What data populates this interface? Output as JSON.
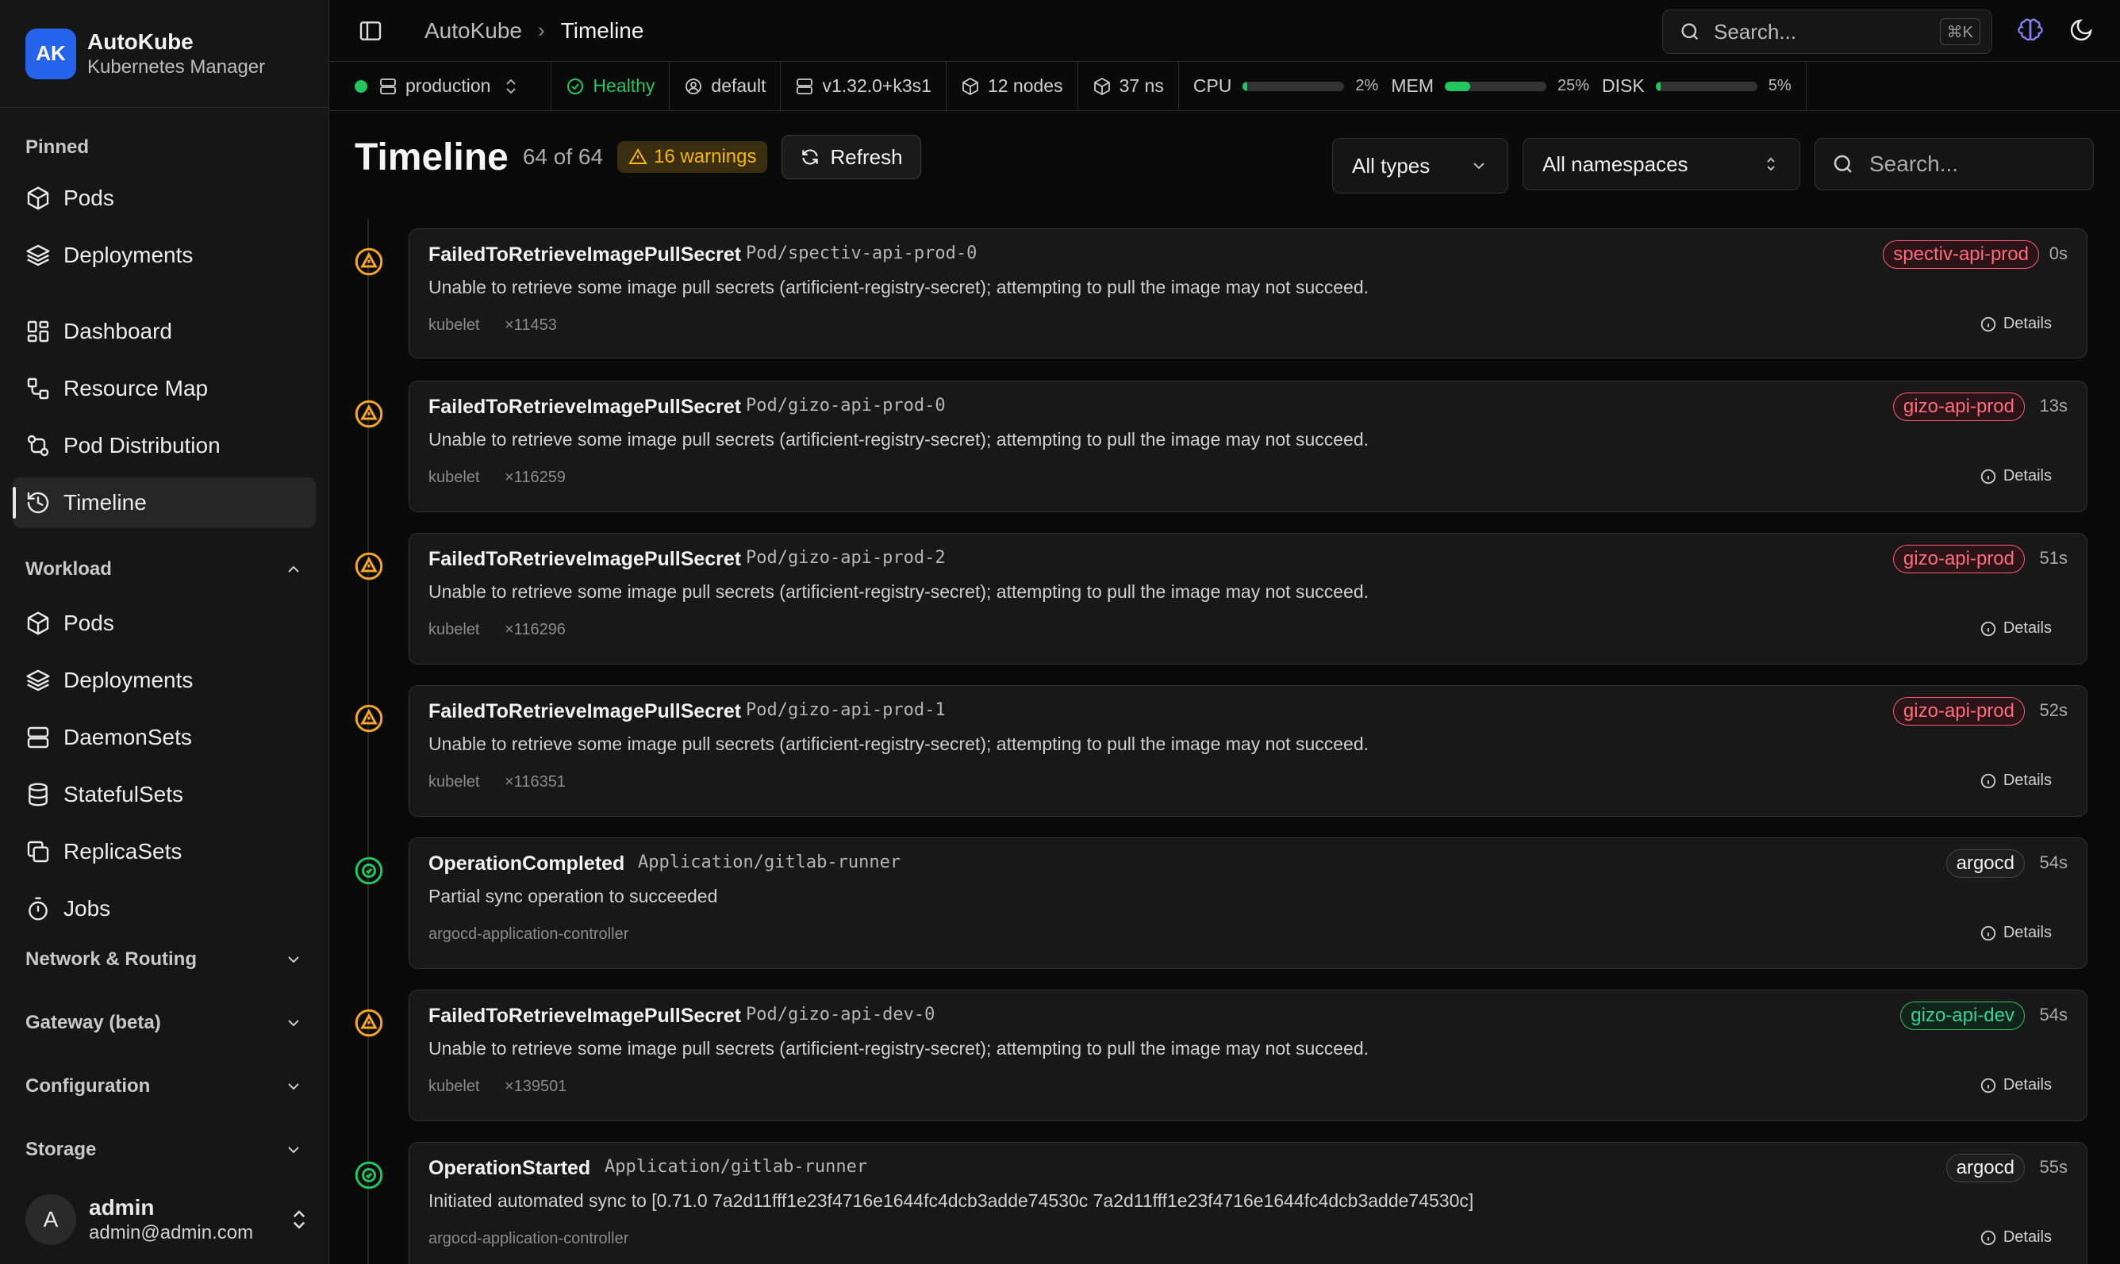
{
  "brand": {
    "logo": "AK",
    "name": "AutoKube",
    "subtitle": "Kubernetes Manager"
  },
  "sidebar": {
    "pinned_label": "Pinned",
    "pinned": [
      {
        "label": "Pods",
        "icon": "cube-icon"
      },
      {
        "label": "Deployments",
        "icon": "layers-icon"
      }
    ],
    "main_items": [
      {
        "label": "Dashboard",
        "icon": "grid-icon"
      },
      {
        "label": "Resource Map",
        "icon": "map-icon"
      },
      {
        "label": "Pod Distribution",
        "icon": "distribution-icon"
      },
      {
        "label": "Timeline",
        "icon": "history-icon",
        "active": true
      }
    ],
    "workload_label": "Workload",
    "workload": [
      {
        "label": "Pods",
        "icon": "cube-icon"
      },
      {
        "label": "Deployments",
        "icon": "layers-icon"
      },
      {
        "label": "DaemonSets",
        "icon": "server-icon"
      },
      {
        "label": "StatefulSets",
        "icon": "database-icon"
      },
      {
        "label": "ReplicaSets",
        "icon": "copy-icon"
      },
      {
        "label": "Jobs",
        "icon": "timer-icon"
      }
    ],
    "collapsed": [
      "Network & Routing",
      "Gateway (beta)",
      "Configuration",
      "Storage"
    ],
    "user": {
      "initial": "A",
      "name": "admin",
      "email": "admin@admin.com"
    }
  },
  "topbar": {
    "breadcrumb": [
      "AutoKube",
      "Timeline"
    ],
    "search_placeholder": "Search...",
    "shortcut": "⌘K"
  },
  "status": {
    "cluster": "production",
    "health": "Healthy",
    "namespace": "default",
    "version": "v1.32.0+k3s1",
    "nodes": "12 nodes",
    "ns_count": "37 ns",
    "cpu_label": "CPU",
    "cpu": "2%",
    "cpu_frac": 0.02,
    "mem_label": "MEM",
    "mem": "25%",
    "mem_frac": 0.25,
    "disk_label": "DISK",
    "disk": "5%",
    "disk_frac": 0.05,
    "accent": "#22c55e"
  },
  "page": {
    "title": "Timeline",
    "count": "64 of 64",
    "warnings": "16 warnings",
    "refresh": "Refresh",
    "type_filter": "All types",
    "ns_filter": "All namespaces",
    "search_placeholder": "Search..."
  },
  "events": [
    {
      "type": "warning",
      "reason": "FailedToRetrieveImagePullSecret",
      "object": "Pod/spectiv-api-prod-0",
      "message": "Unable to retrieve some image pull secrets (artificient-registry-secret); attempting to pull the image may not succeed.",
      "source": "kubelet",
      "count": "×11453",
      "namespace": "spectiv-api-prod",
      "ns_color": "red",
      "age": "0s",
      "details": "Details"
    },
    {
      "type": "warning",
      "reason": "FailedToRetrieveImagePullSecret",
      "object": "Pod/gizo-api-prod-0",
      "message": "Unable to retrieve some image pull secrets (artificient-registry-secret); attempting to pull the image may not succeed.",
      "source": "kubelet",
      "count": "×116259",
      "namespace": "gizo-api-prod",
      "ns_color": "red",
      "age": "13s",
      "details": "Details"
    },
    {
      "type": "warning",
      "reason": "FailedToRetrieveImagePullSecret",
      "object": "Pod/gizo-api-prod-2",
      "message": "Unable to retrieve some image pull secrets (artificient-registry-secret); attempting to pull the image may not succeed.",
      "source": "kubelet",
      "count": "×116296",
      "namespace": "gizo-api-prod",
      "ns_color": "red",
      "age": "51s",
      "details": "Details"
    },
    {
      "type": "warning",
      "reason": "FailedToRetrieveImagePullSecret",
      "object": "Pod/gizo-api-prod-1",
      "message": "Unable to retrieve some image pull secrets (artificient-registry-secret); attempting to pull the image may not succeed.",
      "source": "kubelet",
      "count": "×116351",
      "namespace": "gizo-api-prod",
      "ns_color": "red",
      "age": "52s",
      "details": "Details"
    },
    {
      "type": "normal",
      "reason": "OperationCompleted",
      "object": "Application/gitlab-runner",
      "message": "Partial sync operation to succeeded",
      "source": "argocd-application-controller",
      "count": "",
      "namespace": "argocd",
      "ns_color": "gray",
      "age": "54s",
      "details": "Details"
    },
    {
      "type": "warning",
      "reason": "FailedToRetrieveImagePullSecret",
      "object": "Pod/gizo-api-dev-0",
      "message": "Unable to retrieve some image pull secrets (artificient-registry-secret); attempting to pull the image may not succeed.",
      "source": "kubelet",
      "count": "×139501",
      "namespace": "gizo-api-dev",
      "ns_color": "green",
      "age": "54s",
      "details": "Details"
    },
    {
      "type": "normal",
      "reason": "OperationStarted",
      "object": "Application/gitlab-runner",
      "message": "Initiated automated sync to [0.71.0 7a2d11fff1e23f4716e1644fc4dcb3adde74530c 7a2d11fff1e23f4716e1644fc4dcb3adde74530c]",
      "source": "argocd-application-controller",
      "count": "",
      "namespace": "argocd",
      "ns_color": "gray",
      "age": "55s",
      "details": "Details"
    }
  ]
}
